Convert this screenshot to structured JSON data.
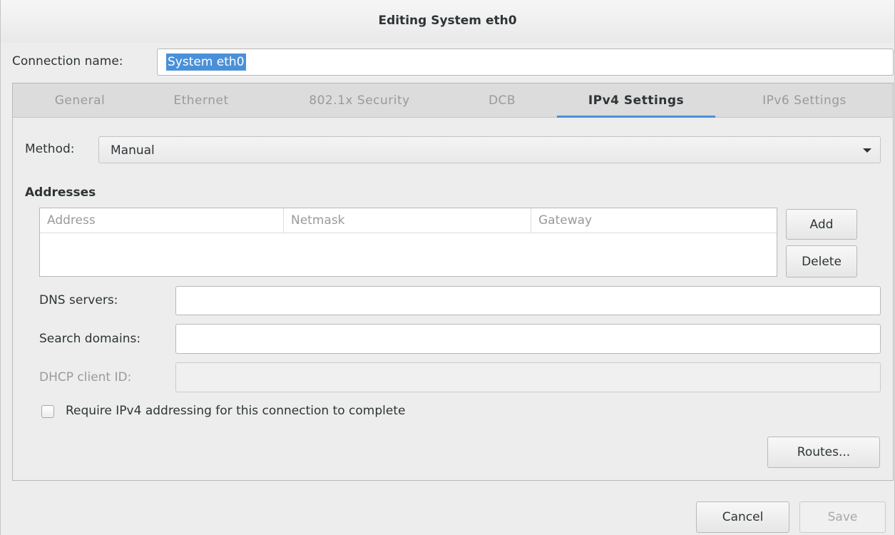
{
  "window": {
    "title": "Editing System eth0"
  },
  "connection": {
    "label": "Connection name:",
    "value": "System eth0"
  },
  "tabs": [
    {
      "label": "General"
    },
    {
      "label": "Ethernet"
    },
    {
      "label": "802.1x Security"
    },
    {
      "label": "DCB"
    },
    {
      "label": "IPv4 Settings",
      "active": true
    },
    {
      "label": "IPv6 Settings"
    }
  ],
  "ipv4": {
    "method_label": "Method:",
    "method_value": "Manual",
    "addresses_title": "Addresses",
    "columns": [
      "Address",
      "Netmask",
      "Gateway"
    ],
    "add_label": "Add",
    "delete_label": "Delete",
    "dns_label": "DNS servers:",
    "dns_value": "",
    "search_label": "Search domains:",
    "search_value": "",
    "dhcp_label": "DHCP client ID:",
    "dhcp_value": "",
    "require_label": "Require IPv4 addressing for this connection to complete",
    "routes_label": "Routes..."
  },
  "footer": {
    "cancel_label": "Cancel",
    "save_label": "Save"
  },
  "colors": {
    "accent": "#4a90d9",
    "background": "#ededed"
  }
}
